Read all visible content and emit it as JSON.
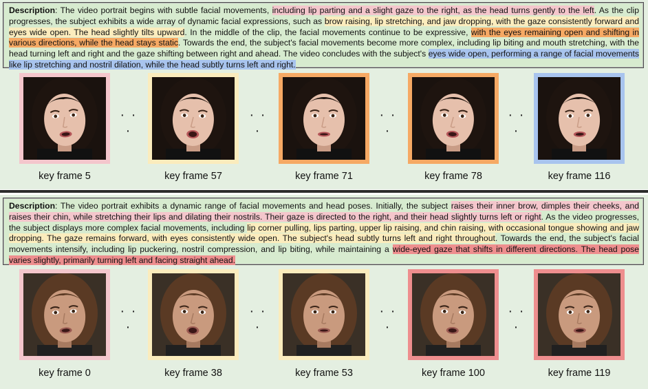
{
  "colors": {
    "pink": "#f4c6cc",
    "yellow": "#fbecbd",
    "orange": "#f6a964",
    "blue": "#a8c4ee",
    "red": "#ee8e8e",
    "panel_bg": "#e4efe1",
    "box_bg": "#d7ebcf"
  },
  "top": {
    "description_label": "Description",
    "segments": [
      {
        "text": ": The video portrait begins with subtle facial movements, ",
        "color": null
      },
      {
        "text": "including lip parting and a slight gaze to the right, as the head turns gently to the left",
        "color": "pink"
      },
      {
        "text": ". As the clip progresses, the subject exhibits a wide array of dynamic facial expressions, such as ",
        "color": null
      },
      {
        "text": "brow raising, lip stretching, and jaw dropping, with the gaze consistently forward and eyes wide open. The head slightly tilts upward",
        "color": "yellow"
      },
      {
        "text": ". In the middle of the clip, the facial movements continue to be expressive, ",
        "color": null
      },
      {
        "text": "with the eyes remaining open and shifting in various directions, while the head stays static",
        "color": "orange"
      },
      {
        "text": ". Towards the end, the subject's facial movements become more complex, including lip biting and mouth stretching, with the head turning left and right and the gaze shifting between right and ahead. The video concludes with the subject's ",
        "color": null
      },
      {
        "text": "eyes wide open, performing a range of facial movements like lip stretching and nostril dilation, while the head subtly turns left and right.",
        "color": "blue"
      }
    ],
    "frames": [
      {
        "label": "key frame 5",
        "border": "pink"
      },
      {
        "label": "key frame 57",
        "border": "yellow"
      },
      {
        "label": "key frame 71",
        "border": "orange"
      },
      {
        "label": "key frame 78",
        "border": "orange"
      },
      {
        "label": "key frame 116",
        "border": "blue"
      }
    ]
  },
  "bottom": {
    "description_label": "Description",
    "segments": [
      {
        "text": ": The video portrait exhibits a dynamic range of facial movements and head poses. Initially, the subject ",
        "color": null
      },
      {
        "text": "raises their inner brow, dimples their cheeks, and raises their chin, while stretching their lips and dilating their nostrils. Their gaze is directed to the right, and their head slightly turns left or right",
        "color": "pink"
      },
      {
        "text": ". As the video progresses, the subject displays more complex facial movements, including ",
        "color": null
      },
      {
        "text": "lip corner pulling, lips parting, upper lip raising, and chin raising, with occasional tongue showing and jaw dropping. The gaze remains forward, with eyes consistently wide open. The subject's head subtly turns left and right throughout",
        "color": "yellow"
      },
      {
        "text": ". Towards the end, the subject's facial movements intensify, including lip puckering, nostril compression, and lip biting, while maintaining a ",
        "color": null
      },
      {
        "text": "wide-eyed gaze that shifts in different directions. The head pose varies slightly, primarily turning left and facing straight ahead.",
        "color": "red"
      }
    ],
    "frames": [
      {
        "label": "key frame 0",
        "border": "pink"
      },
      {
        "label": "key frame 38",
        "border": "yellow"
      },
      {
        "label": "key frame 53",
        "border": "yellow"
      },
      {
        "label": "key frame 100",
        "border": "red"
      },
      {
        "label": "key frame 119",
        "border": "red"
      }
    ]
  },
  "ellipsis": "· · ·"
}
